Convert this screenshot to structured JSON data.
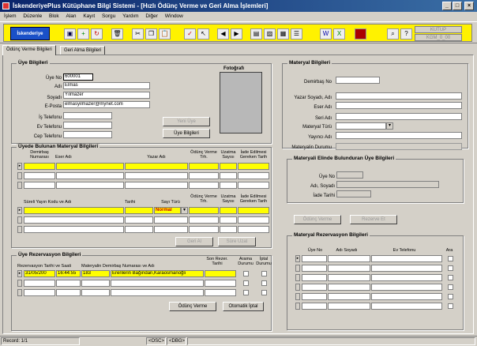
{
  "window": {
    "title": "İskenderiyePlus Kütüphane Bilgi Sistemi - [Hızlı Ödünç Verme ve Geri Alma İşlemleri]"
  },
  "menu": [
    "İşlem",
    "Düzenle",
    "Blok",
    "Alan",
    "Kayıt",
    "Sorgu",
    "Yardım",
    "Diğer",
    "Window"
  ],
  "toolbar": {
    "logo": "İskenderiye",
    "kutup": "KUTUP",
    "kgm": "KGM_0_00"
  },
  "tabs": [
    "Ödünç Verme Bilgileri",
    "Geri Alma Bilgileri"
  ],
  "uye": {
    "title": "Üye Bilgileri",
    "labels": {
      "no": "Üye No",
      "adi": "Adı",
      "soyadi": "Soyadı",
      "eposta": "E-Posta",
      "is_tel": "İş Telefonu",
      "ev_tel": "Ev Telefonu",
      "cep_tel": "Cep Telefonu"
    },
    "values": {
      "no": "600001",
      "adi": "Elmas",
      "soyadi": "Yılmazer",
      "eposta": "elmasyilmazer@mynet.com",
      "is_tel": "",
      "ev_tel": "",
      "cep_tel": ""
    },
    "fotograf": "Fotoğrafı",
    "yeni_uye": "Yeni Üye",
    "uye_bilgileri": "Üye Bilgileri"
  },
  "mat_list": {
    "title": "Üyede Bulunan Materyal Bilgileri",
    "headers": [
      "Demirbaş Numarası",
      "Eser Adı",
      "Yazar Adı",
      "Ödünç Verme Trh.",
      "Uzatma Sayısı",
      "İade Edilmesi Gereken Tarih"
    ],
    "headers2": [
      "Süreli Yayın Kodu ve Adı",
      "Tarihi",
      "Sayı Türü",
      "Ödünç Verme Trh.",
      "Uzatma Sayısı",
      "İade Edilmesi Gereken Tarih"
    ],
    "sayi_turu": "Normal",
    "geri_al": "Geri Al",
    "sure_uzat": "Süre Uzat"
  },
  "rez": {
    "title": "Üye Rezervasyon Bilgileri",
    "headers": [
      "Rezervasyon Tarihi ve Saati",
      "Materyalin Demirbaş Numarası ve Adı",
      "Son Rezer. Tarihi",
      "Arama Durumu",
      "İptal Durumu"
    ],
    "row": {
      "tarih": "31/05/200",
      "saat": "16:44:55",
      "no": "183",
      "ad": "Erenlerin Bağından,Karaosmanoğlı"
    },
    "odunc_verme": "Ödünç Verme",
    "otomatik_iptal": "Otomatik İptal"
  },
  "materyal": {
    "title": "Materyal Bilgileri",
    "labels": {
      "demirbas": "Demirbaş No",
      "yazar": "Yazar Soyadı, Adı",
      "eser": "Eser Adı",
      "seri": "Seri Adı",
      "tur": "Materyal Türü",
      "yayinci": "Yayıncı Adı",
      "durum": "Materyalin Durumu"
    },
    "elinde_title": "Materyali Elinde Bulunduran Üye Bilgileri",
    "elinde_labels": {
      "uye_no": "Üye No",
      "adi": "Adı, Soyadı",
      "iade": "İade Tarihi"
    },
    "odunc_verme": "Ödünç Verme",
    "rezerve_et": "Rezerve Et"
  },
  "mat_rez": {
    "title": "Materyal Rezervasyon Bilgileri",
    "headers": [
      "Üye No",
      "Adı Soyadı",
      "Ev Telefonu",
      "Ara"
    ]
  },
  "status": {
    "record": "Record: 1/1",
    "osc": "<OSC>",
    "dbg": "<DBG>"
  }
}
